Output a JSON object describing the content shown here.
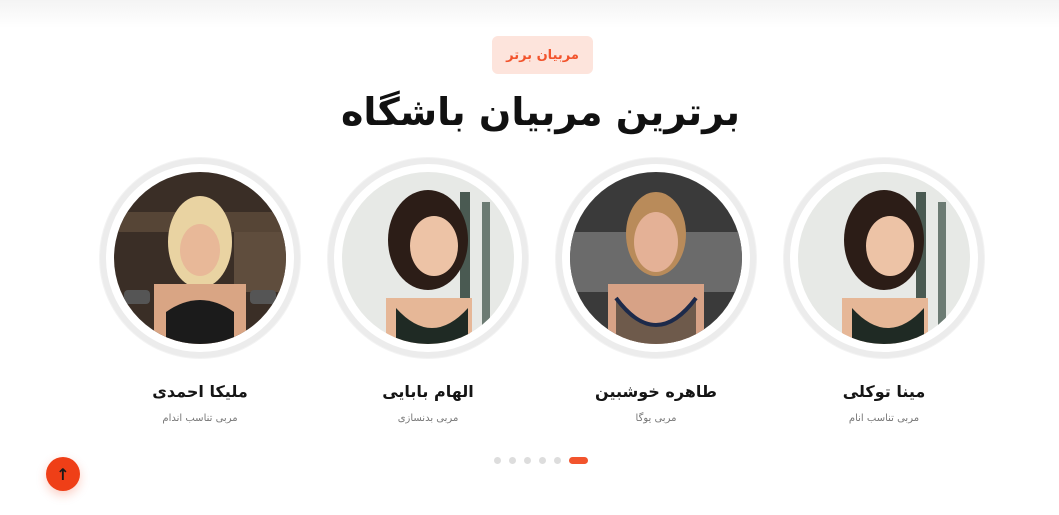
{
  "section": {
    "badge": "مربیان برتر",
    "title": "برترین مربیان باشگاه"
  },
  "trainers": [
    {
      "name": "ملیکا احمدی",
      "role": "مربی تناسب اندام"
    },
    {
      "name": "الهام بابایی",
      "role": "مربی بدنسازی"
    },
    {
      "name": "طاهره خوشبین",
      "role": "مربی یوگا"
    },
    {
      "name": "مینا توکلی",
      "role": "مربی تناسب انام"
    }
  ],
  "carousel": {
    "dot_count": 6,
    "active_dot": 6
  },
  "colors": {
    "accent": "#f2542d",
    "badge_bg": "#fde4dc",
    "ring": "#ececec"
  },
  "icons": {
    "scroll_top": "arrow-up-icon"
  }
}
